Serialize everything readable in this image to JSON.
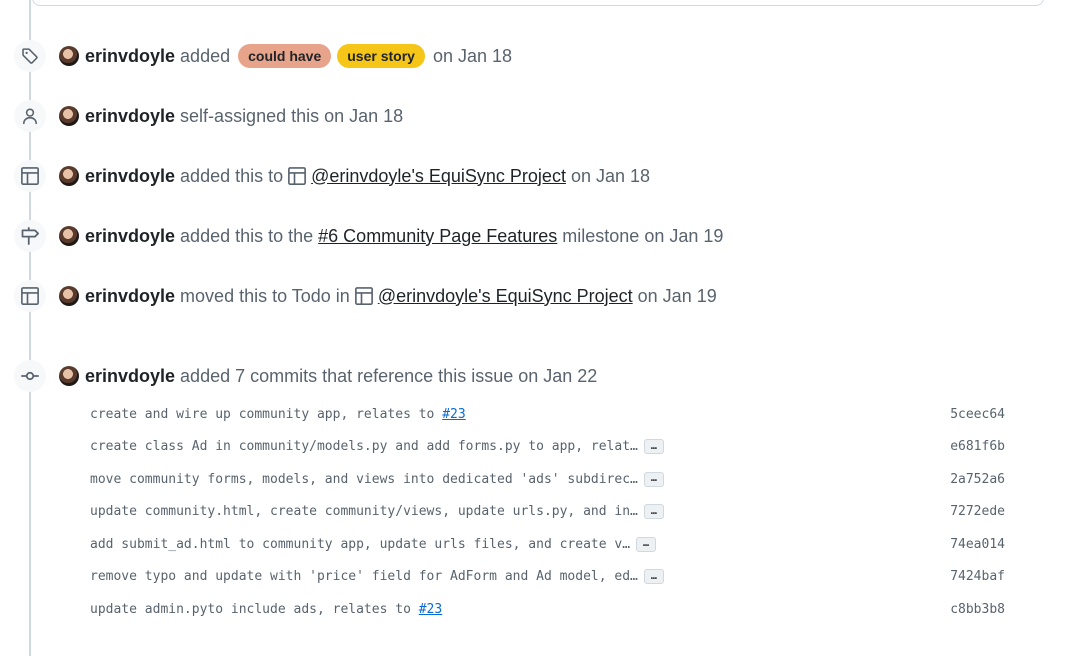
{
  "events": [
    {
      "id": "labeled",
      "icon": "tag-icon",
      "author": "erinvdoyle",
      "pre": "added",
      "labels": [
        {
          "name": "could have",
          "color": "#e8a48a"
        },
        {
          "name": "user story",
          "color": "#f5c518"
        }
      ],
      "post": "on Jan 18"
    },
    {
      "id": "assigned",
      "icon": "person-icon",
      "author": "erinvdoyle",
      "text": "self-assigned this on Jan 18"
    },
    {
      "id": "project-added",
      "icon": "table-icon",
      "author": "erinvdoyle",
      "pre": "added this to",
      "link": "@erinvdoyle's EquiSync Project",
      "post": "on Jan 18"
    },
    {
      "id": "milestone",
      "icon": "milestone-icon",
      "author": "erinvdoyle",
      "pre": "added this to the",
      "link": "#6 Community Page Features",
      "post": "milestone on Jan 19"
    },
    {
      "id": "project-moved",
      "icon": "table-icon",
      "author": "erinvdoyle",
      "pre": "moved this to Todo in",
      "link": "@erinvdoyle's EquiSync Project",
      "post": "on Jan 19"
    },
    {
      "id": "commits",
      "icon": "git-commit-icon",
      "author": "erinvdoyle",
      "text": "added 7 commits that reference this issue on Jan 22"
    }
  ],
  "commits": [
    {
      "msg": "create and wire up community app, relates to ",
      "ref": "#23",
      "truncated": false,
      "sha": "5ceec64"
    },
    {
      "msg": "create class Ad in community/models.py and add forms.py to app, relat…",
      "ref": "",
      "truncated": true,
      "sha": "e681f6b"
    },
    {
      "msg": "move community forms, models, and views into dedicated 'ads' subdirec…",
      "ref": "",
      "truncated": true,
      "sha": "2a752a6"
    },
    {
      "msg": "update community.html, create community/views, update urls.py, and in…",
      "ref": "",
      "truncated": true,
      "sha": "7272ede"
    },
    {
      "msg": "add submit_ad.html to community app, update urls files, and create v…",
      "ref": "",
      "truncated": true,
      "sha": "74ea014"
    },
    {
      "msg": "remove typo and update with 'price' field for AdForm and Ad model, ed…",
      "ref": "",
      "truncated": true,
      "sha": "7424baf"
    },
    {
      "msg": "update admin.pyto include ads, relates to ",
      "ref": "#23",
      "truncated": false,
      "sha": "c8bb3b8"
    }
  ],
  "ellipsis_label": "…"
}
